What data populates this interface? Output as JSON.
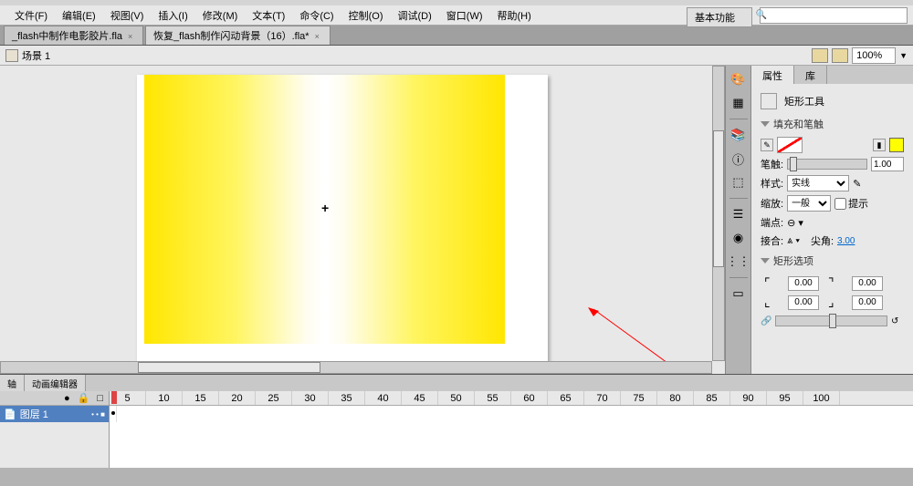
{
  "menu": {
    "file": "文件(F)",
    "edit": "编辑(E)",
    "view": "视图(V)",
    "insert": "插入(I)",
    "modify": "修改(M)",
    "text": "文本(T)",
    "commands": "命令(C)",
    "control": "控制(O)",
    "debug": "调试(D)",
    "window": "窗口(W)",
    "help": "帮助(H)"
  },
  "workspace": "基本功能",
  "tabs": [
    "_flash中制作电影胶片.fla",
    "恢复_flash制作闪动背景（16）.fla*"
  ],
  "scene": "场景 1",
  "zoom": "100%",
  "properties": {
    "tab_props": "属性",
    "tab_lib": "库",
    "tool_name": "矩形工具",
    "section_fill": "填充和笔触",
    "stroke": "笔触:",
    "stroke_val": "1.00",
    "style": "样式:",
    "style_val": "实线",
    "scale": "缩放:",
    "scale_val": "一般",
    "hint_chk": "提示",
    "cap": "端点:",
    "join": "接合:",
    "miter": "尖角:",
    "miter_val": "3.00",
    "section_rect": "矩形选项",
    "corner_val": "0.00"
  },
  "timeline": {
    "tab1": "轴",
    "tab2": "动画编辑器",
    "layer1": "图层 1"
  }
}
